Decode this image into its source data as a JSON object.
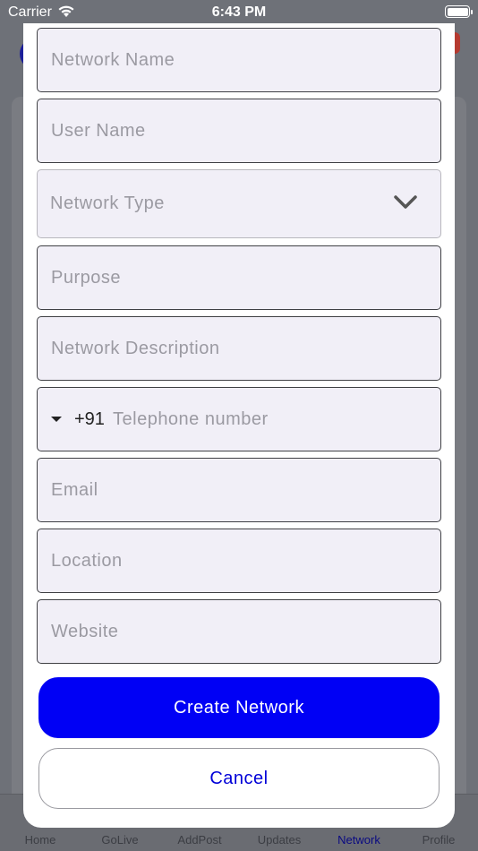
{
  "status_bar": {
    "carrier": "Carrier",
    "time": "6:43 PM"
  },
  "form": {
    "network_name_placeholder": "Network Name",
    "user_name_placeholder": "User Name",
    "network_type_placeholder": "Network Type",
    "purpose_placeholder": "Purpose",
    "description_placeholder": "Network Description",
    "phone_country_code": "+91",
    "phone_placeholder": "Telephone number",
    "email_placeholder": "Email",
    "location_placeholder": "Location",
    "website_placeholder": "Website"
  },
  "actions": {
    "create_label": "Create Network",
    "cancel_label": "Cancel"
  },
  "tab_bar": {
    "items": [
      {
        "label": "Home"
      },
      {
        "label": "GoLive"
      },
      {
        "label": "AddPost"
      },
      {
        "label": "Updates"
      },
      {
        "label": "Network"
      },
      {
        "label": "Profile"
      }
    ],
    "active": "Network"
  },
  "colors": {
    "primary_button": "#0000f5",
    "cancel_text": "#0000d8",
    "active_tab": "#0a0a82",
    "field_background": "#f1eff7"
  },
  "icons": {
    "wifi": "wifi-icon",
    "battery": "battery-icon",
    "dropdown": "chevron-down-icon",
    "country_picker": "caret-down-icon"
  }
}
